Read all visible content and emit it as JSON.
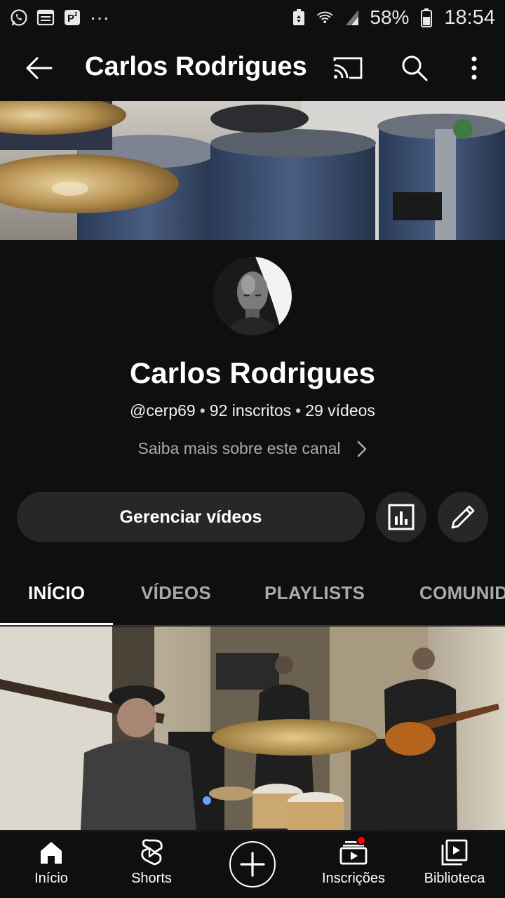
{
  "status_bar": {
    "notification_more": "···",
    "battery_percent": "58%",
    "time": "18:54"
  },
  "app_bar": {
    "title": "Carlos Rodrigues"
  },
  "channel": {
    "name": "Carlos Rodrigues",
    "handle": "@cerp69",
    "subscribers": "92 inscritos",
    "videos": "29 vídeos",
    "separator": "•",
    "about_link": "Saiba mais sobre este canal"
  },
  "actions": {
    "manage_videos": "Gerenciar vídeos"
  },
  "tabs": [
    {
      "label": "INÍCIO"
    },
    {
      "label": "VÍDEOS"
    },
    {
      "label": "PLAYLISTS"
    },
    {
      "label": "COMUNIDADE"
    }
  ],
  "bottom_nav": [
    {
      "label": "Início",
      "icon": "home-icon"
    },
    {
      "label": "Shorts",
      "icon": "shorts-icon"
    },
    {
      "label": "",
      "icon": "create-icon"
    },
    {
      "label": "Inscrições",
      "icon": "subscriptions-icon"
    },
    {
      "label": "Biblioteca",
      "icon": "library-icon"
    }
  ],
  "colors": {
    "background": "#0f0f0f",
    "surface": "#272727",
    "text_secondary": "#aaaaaa",
    "notification_dot": "#ff0000"
  }
}
